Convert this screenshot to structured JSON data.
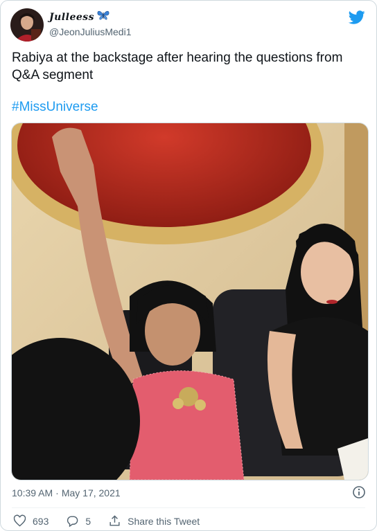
{
  "author": {
    "display_name": "Julleess",
    "handle": "@JeonJuliusMedi1",
    "name_emoji": "butterfly-icon"
  },
  "tweet": {
    "text": "Rabiya at the backstage after hearing the questions from Q&A segment",
    "hashtag": "#MissUniverse"
  },
  "meta": {
    "time": "10:39 AM",
    "separator": "·",
    "date": "May 17, 2021"
  },
  "actions": {
    "likes": "693",
    "replies": "5",
    "share_label": "Share this Tweet"
  },
  "colors": {
    "accent": "#1d9bf0",
    "text": "#0f1419",
    "secondary": "#536471",
    "border": "#cfd9de"
  }
}
